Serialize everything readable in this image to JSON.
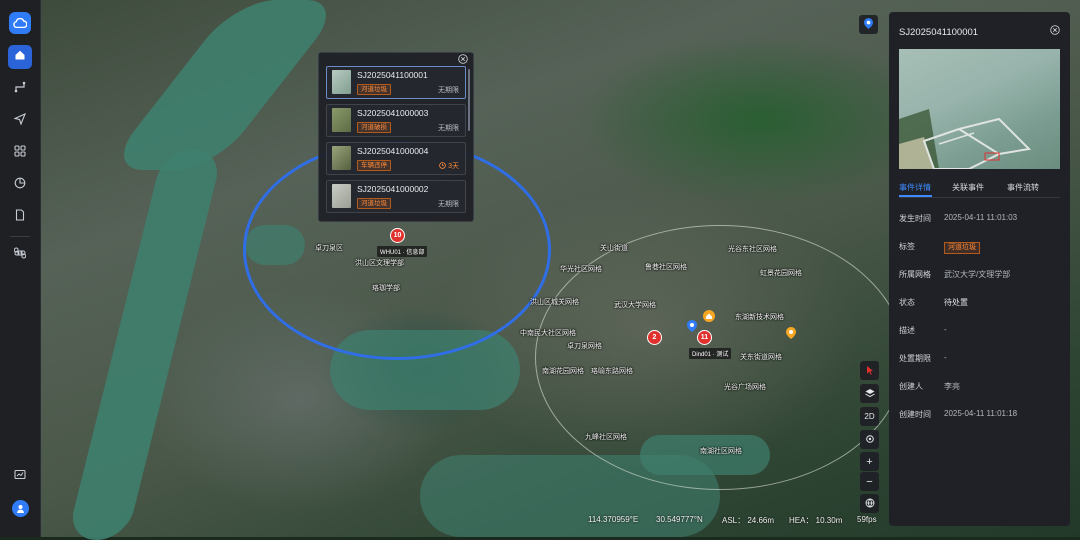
{
  "popup": {
    "events": [
      {
        "id": "SJ2025041100001",
        "tag": "河道垃圾",
        "deadline": "无期限"
      },
      {
        "id": "SJ2025041000003",
        "tag": "河道破损",
        "deadline": "无期限"
      },
      {
        "id": "SJ2025041000004",
        "tag": "车辆违停",
        "deadline": "3天"
      },
      {
        "id": "SJ2025041000002",
        "tag": "河道垃圾",
        "deadline": "无期限"
      }
    ]
  },
  "map": {
    "labels": [
      "洪山区文理学部",
      "珞珈学部",
      "卓刀泉区",
      "关山街道",
      "鲁巷社区网格",
      "光谷东社区网格",
      "华光社区网格",
      "洪山区城关网格",
      "中南民大社区网格",
      "卓刀泉网格",
      "南湖花园网格",
      "珞喻东路网格",
      "武汉大学网格",
      "东湖新技术网格",
      "虹景花园网格",
      "关东街道网格",
      "光谷广场网格",
      "九峰社区网格",
      "南湖社区网格"
    ],
    "marker_cluster": "10",
    "marker_a": "2",
    "marker_b": "11",
    "pin_label_1": "WHU01 · 信息部",
    "pin_label_2": "Dind01 · 测试"
  },
  "controls": {
    "mode_2d": "2D",
    "zoom_in": "+",
    "zoom_out": "−"
  },
  "status": {
    "lon": "114.370959°E",
    "lat": "30.549777°N",
    "asl": "ASL： 24.66m",
    "hea": "HEA： 10.30m",
    "fps": "59fps"
  },
  "panel": {
    "title": "SJ2025041100001",
    "tabs": [
      "事件详情",
      "关联事件",
      "事件流转"
    ],
    "fields": [
      {
        "key": "发生时间",
        "value": "2025-04-11 11:01:03"
      },
      {
        "key": "标签",
        "value": "河道垃圾"
      },
      {
        "key": "所属网格",
        "value": "武汉大学/文理学部"
      },
      {
        "key": "状态",
        "value": "待处置"
      },
      {
        "key": "描述",
        "value": "-"
      },
      {
        "key": "处置期限",
        "value": "-"
      },
      {
        "key": "创建人",
        "value": "李亮"
      },
      {
        "key": "创建时间",
        "value": "2025-04-11 11:01:18"
      }
    ]
  },
  "colors": {
    "accent": "#2f7cf6",
    "tag_orange": "#ff8c3b",
    "circle_blue": "#2f6ee6",
    "badge_red": "#e0312f"
  },
  "icons": [
    "cloud-logo-icon",
    "home-icon",
    "route-icon",
    "send-icon",
    "grid-icon",
    "pie-chart-icon",
    "document-icon",
    "command-icon",
    "monitor-chart-icon",
    "user-avatar-icon",
    "close-icon",
    "location-pin-icon",
    "cursor-icon",
    "layers-icon",
    "target-icon",
    "globe-icon"
  ]
}
